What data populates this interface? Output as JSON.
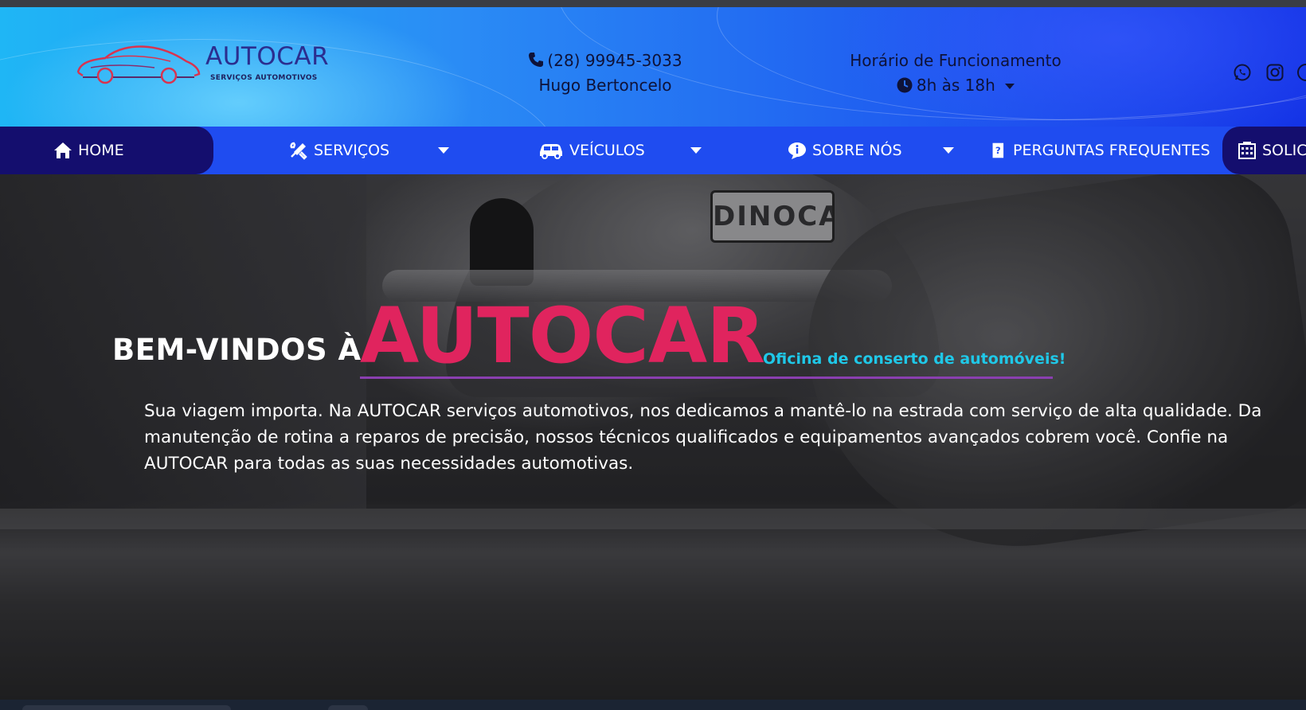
{
  "brand": {
    "name": "AUTOCAR",
    "subtitle": "SERVIÇOS AUTOMOTIVOS"
  },
  "contact": {
    "phone": "(28) 99945-3033",
    "person": "Hugo Bertoncelo"
  },
  "hours": {
    "title": "Horário de Funcionamento",
    "value": "8h às 18h"
  },
  "social": [
    "whatsapp-icon",
    "instagram-icon",
    "facebook-icon"
  ],
  "nav": {
    "home": "HOME",
    "servicos": "SERVIÇOS",
    "veiculos": "VEÍCULOS",
    "sobre": "SOBRE NÓS",
    "faq": "PERGUNTAS FREQUENTES",
    "solic": "SOLIC"
  },
  "hero": {
    "welcome": "BEM-VINDOS À",
    "brand": "AUTOCAR",
    "tagline": "Oficina de conserto de automóveis!",
    "plate": "DINOCAR",
    "description": "Sua viagem importa. Na AUTOCAR serviços automotivos, nos dedicamos a mantê-lo na estrada com serviço de alta qualidade. Da manutenção de rotina a reparos de precisão, nossos técnicos qualificados e equipamentos avançados cobrem você. Confie na AUTOCAR para todas as suas necessidades automotivas."
  },
  "colors": {
    "nav_bg": "#1f4cf0",
    "nav_active": "#140e6e",
    "brand_pink": "#e0245e",
    "tagline_cyan": "#1fc8e8",
    "underline_purple": "#8a3fb0"
  }
}
